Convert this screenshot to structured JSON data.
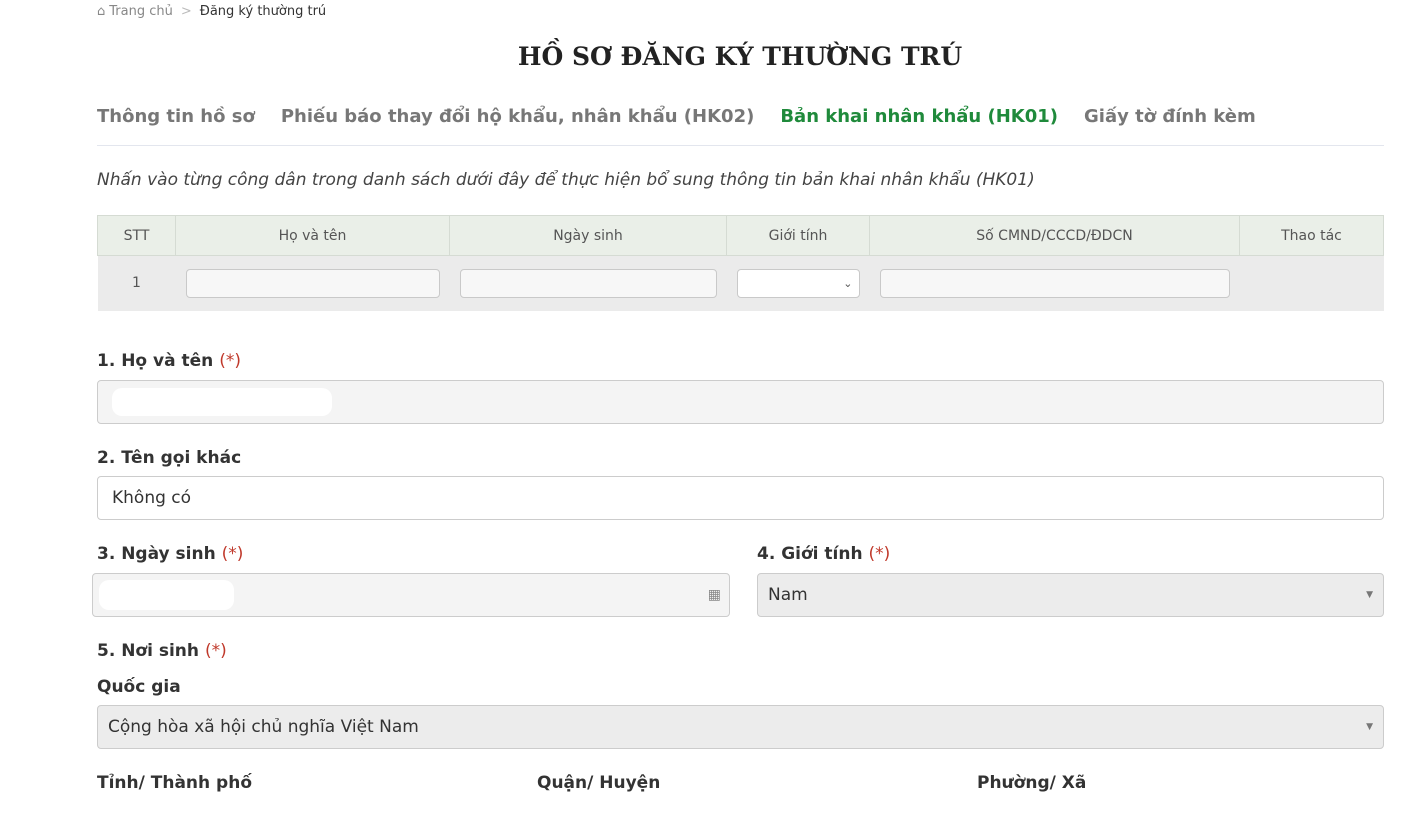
{
  "breadcrumb": {
    "home": "Trang chủ",
    "sep": ">",
    "current": "Đăng ký thường trú"
  },
  "title": "HỒ SƠ ĐĂNG KÝ THƯỜNG TRÚ",
  "tabs": [
    {
      "label": "Thông tin hồ sơ"
    },
    {
      "label": "Phiếu báo thay đổi hộ khẩu, nhân khẩu (HK02)"
    },
    {
      "label": "Bản khai nhân khẩu (HK01)"
    },
    {
      "label": "Giấy tờ đính kèm"
    }
  ],
  "hint": "Nhấn vào từng công dân trong danh sách dưới đây để thực hiện bổ sung thông tin bản khai nhân khẩu (HK01)",
  "table": {
    "headers": [
      "STT",
      "Họ và tên",
      "Ngày sinh",
      "Giới tính",
      "Số CMND/CCCD/ĐDCN",
      "Thao tác"
    ],
    "rows": [
      {
        "stt": "1"
      }
    ]
  },
  "form": {
    "req": "(*)",
    "name_label": "1. Họ và tên",
    "alias_label": "2. Tên gọi khác",
    "alias_value": "Không có",
    "dob_label": "3. Ngày sinh",
    "gender_label": "4. Giới tính",
    "gender_value": "Nam",
    "birthplace_label": "5. Nơi sinh",
    "country_label": "Quốc gia",
    "country_value": "Cộng hòa xã hội chủ nghĩa Việt Nam",
    "province_label": "Tỉnh/ Thành phố",
    "district_label": "Quận/ Huyện",
    "ward_label": "Phường/ Xã"
  }
}
